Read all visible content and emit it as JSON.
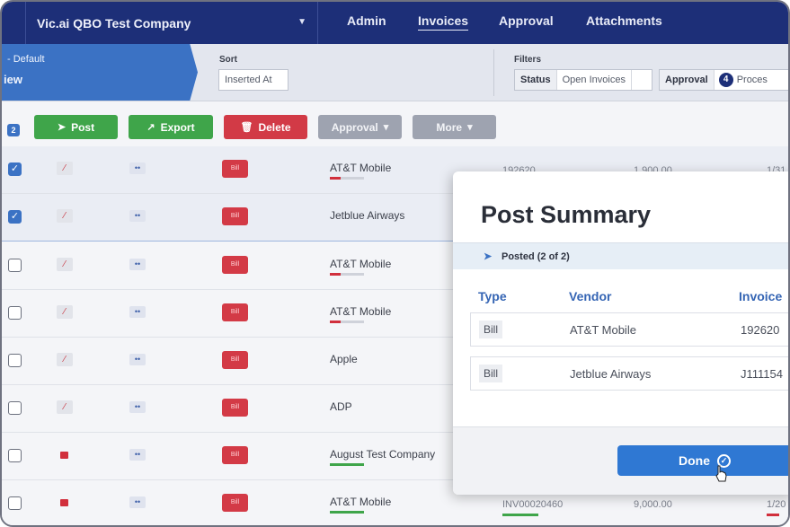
{
  "topbar": {
    "company": "Vic.ai QBO Test Company",
    "nav": [
      "Admin",
      "Invoices",
      "Approval",
      "Attachments"
    ],
    "active_nav": "Invoices"
  },
  "subheader": {
    "view_default": "- Default",
    "view_name": "iew",
    "sort_label": "Sort",
    "sort_value": "Inserted At",
    "filters_label": "Filters",
    "filter_group1": [
      "Status",
      "Open Invoices"
    ],
    "filter_group2_label": "Approval",
    "filter_group2_count": "4",
    "filter_group2_value": "Proces"
  },
  "toolbar": {
    "selected_count": "2",
    "post": "Post",
    "export": "Export",
    "delete": "Delete",
    "approval": "Approval",
    "more": "More"
  },
  "rows": [
    {
      "checked": true,
      "vendor": "AT&T Mobile",
      "invoice": "192620",
      "amount": "1,900.00",
      "date": "1/31",
      "type": "Bill"
    },
    {
      "checked": true,
      "vendor": "Jetblue Airways",
      "invoice": "",
      "amount": "",
      "date": "",
      "type": "Bill"
    },
    {
      "checked": false,
      "vendor": "AT&T Mobile",
      "invoice": "",
      "amount": "",
      "date": "",
      "type": "Bill"
    },
    {
      "checked": false,
      "vendor": "AT&T Mobile",
      "invoice": "",
      "amount": "",
      "date": "",
      "type": "Bill"
    },
    {
      "checked": false,
      "vendor": "Apple",
      "invoice": "",
      "amount": "",
      "date": "",
      "type": "Bill"
    },
    {
      "checked": false,
      "vendor": "ADP",
      "invoice": "",
      "amount": "",
      "date": "",
      "type": "Bill"
    },
    {
      "checked": false,
      "vendor": "August Test Company",
      "invoice": "",
      "amount": "",
      "date": "",
      "type": "Bill"
    },
    {
      "checked": false,
      "vendor": "AT&T Mobile",
      "invoice": "INV00020460",
      "amount": "9,000.00",
      "date": "1/20",
      "type": "Bill"
    }
  ],
  "modal": {
    "title": "Post Summary",
    "status": "Posted (2 of 2)",
    "columns": [
      "Type",
      "Vendor",
      "Invoice"
    ],
    "rows": [
      {
        "type": "Bill",
        "vendor": "AT&T Mobile",
        "invoice": "192620"
      },
      {
        "type": "Bill",
        "vendor": "Jetblue Airways",
        "invoice": "J111154"
      }
    ],
    "done": "Done"
  },
  "colors": {
    "navy": "#1d2f78",
    "accent_blue": "#3b72c4",
    "green": "#3fa54a",
    "red": "#d23a46",
    "primary_button": "#2f78d3"
  }
}
